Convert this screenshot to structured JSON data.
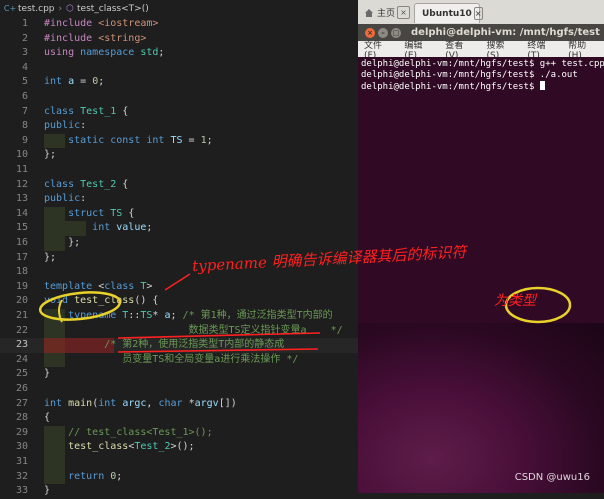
{
  "editor": {
    "breadcrumb": {
      "file": "test.cpp",
      "symbol": "test_class<T>()"
    },
    "lines": [
      {
        "n": "1",
        "html": "<span class=\"pp\">#include</span> <span class=\"st\">&lt;iostream&gt;</span>"
      },
      {
        "n": "2",
        "html": "<span class=\"pp\">#include</span> <span class=\"st\">&lt;string&gt;</span>"
      },
      {
        "n": "3",
        "html": "<span class=\"pp\">using</span> <span class=\"kw\">namespace</span> <span class=\"ty\">std</span>;"
      },
      {
        "n": "4",
        "html": ""
      },
      {
        "n": "5",
        "html": "<span class=\"kw\">int</span> <span class=\"va\">a</span> = <span class=\"nm\">0</span>;"
      },
      {
        "n": "6",
        "html": ""
      },
      {
        "n": "7",
        "html": "<span class=\"kw\">class</span> <span class=\"ty\">Test_1</span> {"
      },
      {
        "n": "8",
        "html": "<span class=\"kw\">public</span>:"
      },
      {
        "n": "9",
        "html": "    <span class=\"kw\">static</span> <span class=\"kw\">const</span> <span class=\"kw\">int</span> <span class=\"va\">TS</span> = <span class=\"nm\">1</span>;"
      },
      {
        "n": "10",
        "html": "};"
      },
      {
        "n": "11",
        "html": ""
      },
      {
        "n": "12",
        "html": "<span class=\"kw\">class</span> <span class=\"ty\">Test_2</span> {"
      },
      {
        "n": "13",
        "html": "<span class=\"kw\">public</span>:"
      },
      {
        "n": "14",
        "html": "    <span class=\"kw\">struct</span> <span class=\"ty\">TS</span> {"
      },
      {
        "n": "15",
        "html": "        <span class=\"kw\">int</span> <span class=\"va\">value</span>;"
      },
      {
        "n": "16",
        "html": "    };"
      },
      {
        "n": "17",
        "html": "};"
      },
      {
        "n": "18",
        "html": ""
      },
      {
        "n": "19",
        "html": "<span class=\"kw\">template</span> &lt;<span class=\"kw\">class</span> <span class=\"ty\">T</span>&gt;"
      },
      {
        "n": "20",
        "html": "<span class=\"kw\">void</span> <span class=\"fn\">test_class</span>() {"
      },
      {
        "n": "21",
        "html": "    <span class=\"kw\">typename</span> <span class=\"ty\">T</span>::<span class=\"ty\">TS</span>* <span class=\"va\">a</span>; <span class=\"cm\">/* 第1种，通过泛指类型T内部的</span>"
      },
      {
        "n": "22",
        "html": "<span class=\"cm\">                        数据类型TS定义指针变量a    */</span>"
      },
      {
        "n": "23",
        "html": "<span class=\"cm\">          /* 第2种，使用泛指类型T内部的静态成</span>"
      },
      {
        "n": "24",
        "html": "<span class=\"cm\">             员变量TS和全局变量a进行乘法操作 */</span>"
      },
      {
        "n": "25",
        "html": "}"
      },
      {
        "n": "26",
        "html": ""
      },
      {
        "n": "27",
        "html": "<span class=\"kw\">int</span> <span class=\"fn\">main</span>(<span class=\"kw\">int</span> <span class=\"va\">argc</span>, <span class=\"kw\">char</span> *<span class=\"va\">argv</span>[])"
      },
      {
        "n": "28",
        "html": "{"
      },
      {
        "n": "29",
        "html": "    <span class=\"cm\">// test_class&lt;Test_1&gt;();</span>"
      },
      {
        "n": "30",
        "html": "    <span class=\"fn\">test_class</span>&lt;<span class=\"ty\">Test_2</span>&gt;();"
      },
      {
        "n": "31",
        "html": ""
      },
      {
        "n": "32",
        "html": "    <span class=\"kw\">return</span> <span class=\"nm\">0</span>;"
      },
      {
        "n": "33",
        "html": "}"
      }
    ],
    "active_line": "23"
  },
  "terminal": {
    "tabs": {
      "home": "主页",
      "ubuntu": "Ubuntu10"
    },
    "title": "delphi@delphi-vm: /mnt/hgfs/test",
    "menu": [
      "文件(F)",
      "编辑(E)",
      "查看(V)",
      "搜索(S)",
      "终端(T)",
      "帮助(H)"
    ],
    "lines": [
      "delphi@delphi-vm:/mnt/hgfs/test$ g++ test.cpp",
      "delphi@delphi-vm:/mnt/hgfs/test$ ./a.out",
      "delphi@delphi-vm:/mnt/hgfs/test$ "
    ]
  },
  "annotations": {
    "note_1": "typename 明确告诉编译器其后的标识符",
    "note_2": "为类型"
  },
  "watermark": "CSDN @uwu16",
  "colors": {
    "annotation": "#ff2020",
    "terminal_bg": "#300a24",
    "editor_bg": "#1e1e1e"
  }
}
